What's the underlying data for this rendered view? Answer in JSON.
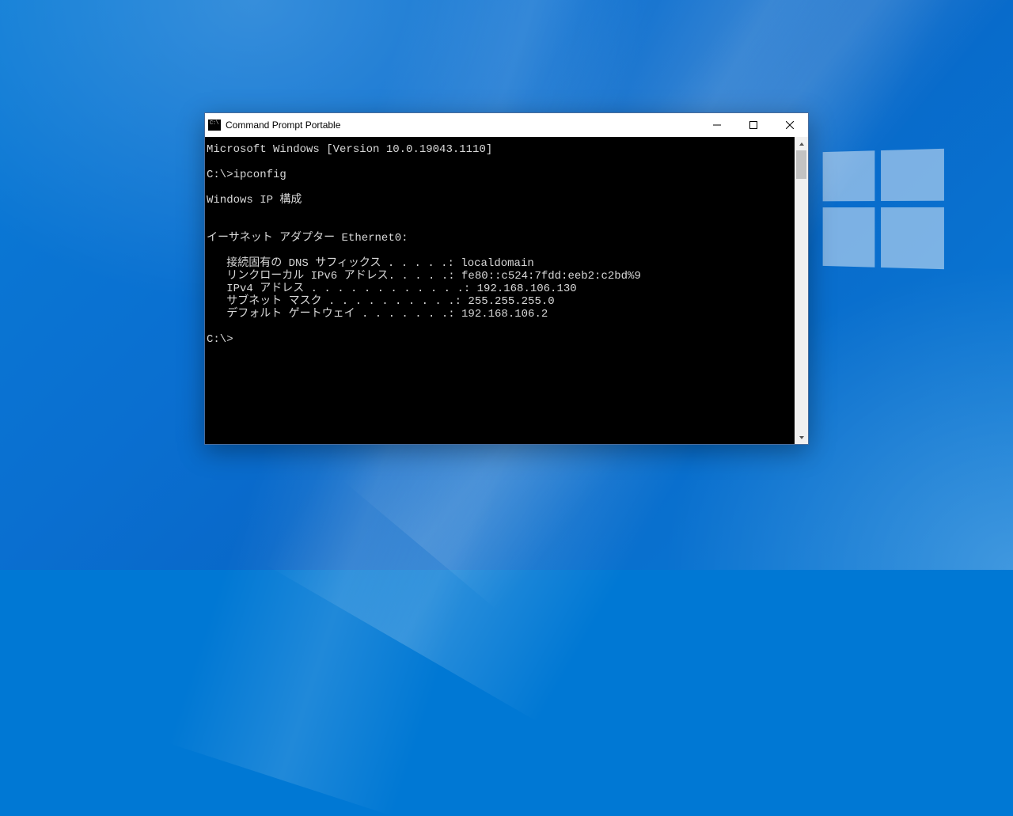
{
  "window": {
    "title": "Command Prompt Portable"
  },
  "console": {
    "lines": [
      "Microsoft Windows [Version 10.0.19043.1110]",
      "",
      "C:\\>ipconfig",
      "",
      "Windows IP 構成",
      "",
      "",
      "イーサネット アダプター Ethernet0:",
      "",
      "   接続固有の DNS サフィックス . . . . .: localdomain",
      "   リンクローカル IPv6 アドレス. . . . .: fe80::c524:7fdd:eeb2:c2bd%9",
      "   IPv4 アドレス . . . . . . . . . . . .: 192.168.106.130",
      "   サブネット マスク . . . . . . . . . .: 255.255.255.0",
      "   デフォルト ゲートウェイ . . . . . . .: 192.168.106.2",
      "",
      "C:\\>"
    ]
  }
}
